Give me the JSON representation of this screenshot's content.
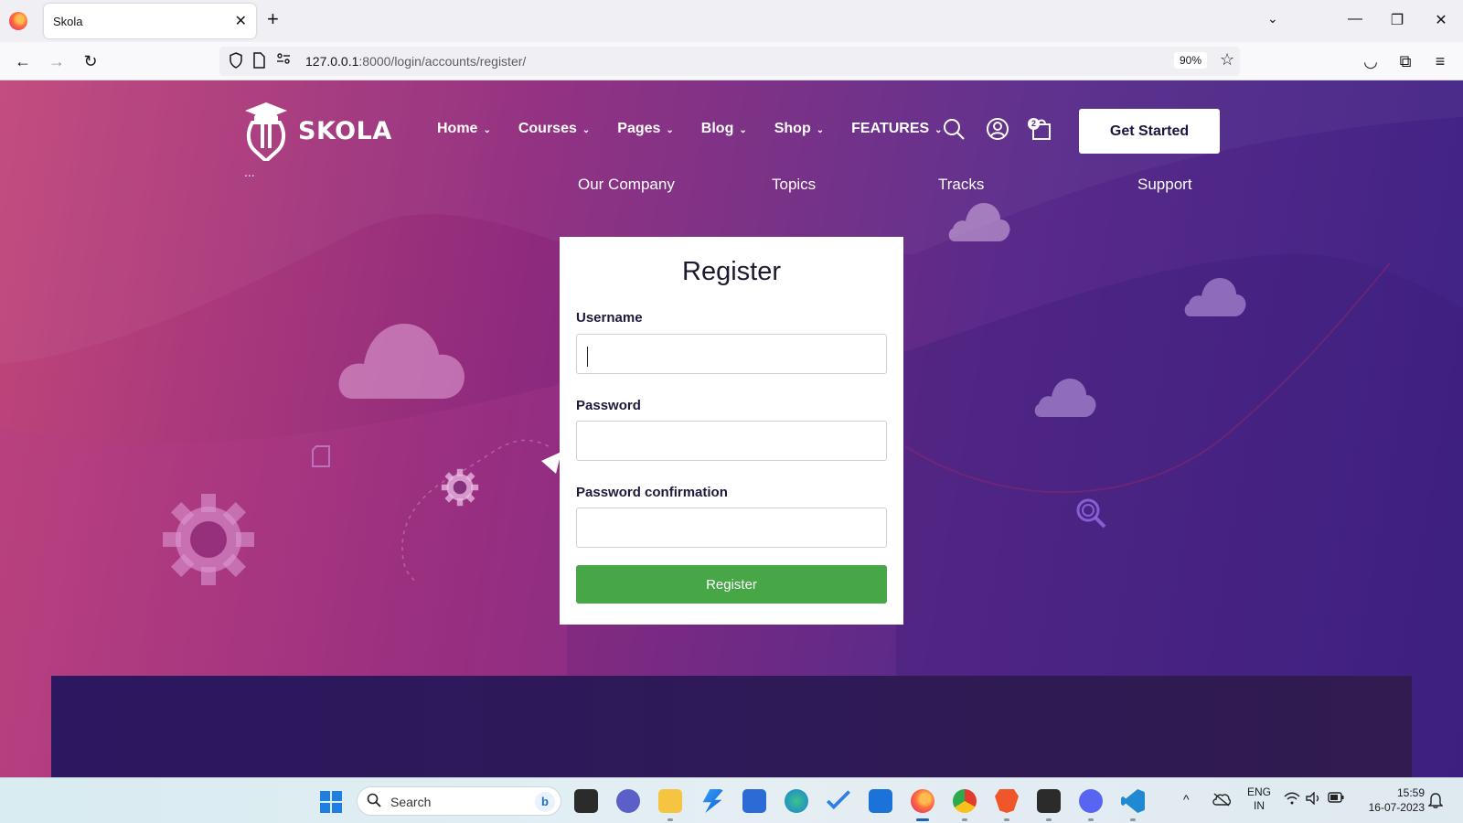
{
  "browser": {
    "tab_title": "Skola",
    "tab_close": "✕",
    "new_tab": "+",
    "tab_list": "⌄",
    "window": {
      "minimize": "—",
      "restore": "❐",
      "close": "✕"
    },
    "url_host": "127.0.0.1",
    "url_path": ":8000/login/accounts/register/",
    "zoom": "90%",
    "nav": {
      "back": "←",
      "forward": "→",
      "reload": "↻"
    },
    "bookmark_icon": "☆",
    "toolbar_icons": {
      "pocket": "◡",
      "extensions": "⧉",
      "menu": "≡"
    }
  },
  "site": {
    "brand": "SKOLA",
    "menu": [
      {
        "label": "Home"
      },
      {
        "label": "Courses"
      },
      {
        "label": "Pages"
      },
      {
        "label": "Blog"
      },
      {
        "label": "Shop"
      },
      {
        "label": "FEATURES"
      }
    ],
    "menu_chevron": "⌄",
    "cart_count": "2",
    "cta": "Get Started"
  },
  "form": {
    "title": "Register",
    "username_label": "Username",
    "username_value": "",
    "password_label": "Password",
    "password_value": "",
    "confirm_label": "Password confirmation",
    "confirm_value": "",
    "submit": "Register"
  },
  "footer": {
    "dots": "...",
    "columns": [
      "Our Company",
      "Topics",
      "Tracks",
      "Support"
    ]
  },
  "taskbar": {
    "search_placeholder": "Search",
    "bing_label": "b",
    "language": "ENG",
    "region": "IN",
    "time": "15:59",
    "date": "16-07-2023",
    "tray_arrow": "^"
  },
  "colors": {
    "register_button": "#47a747",
    "page_gradient_start": "#c1467a",
    "page_gradient_end": "#3d2285",
    "footer": "#2b1860"
  }
}
